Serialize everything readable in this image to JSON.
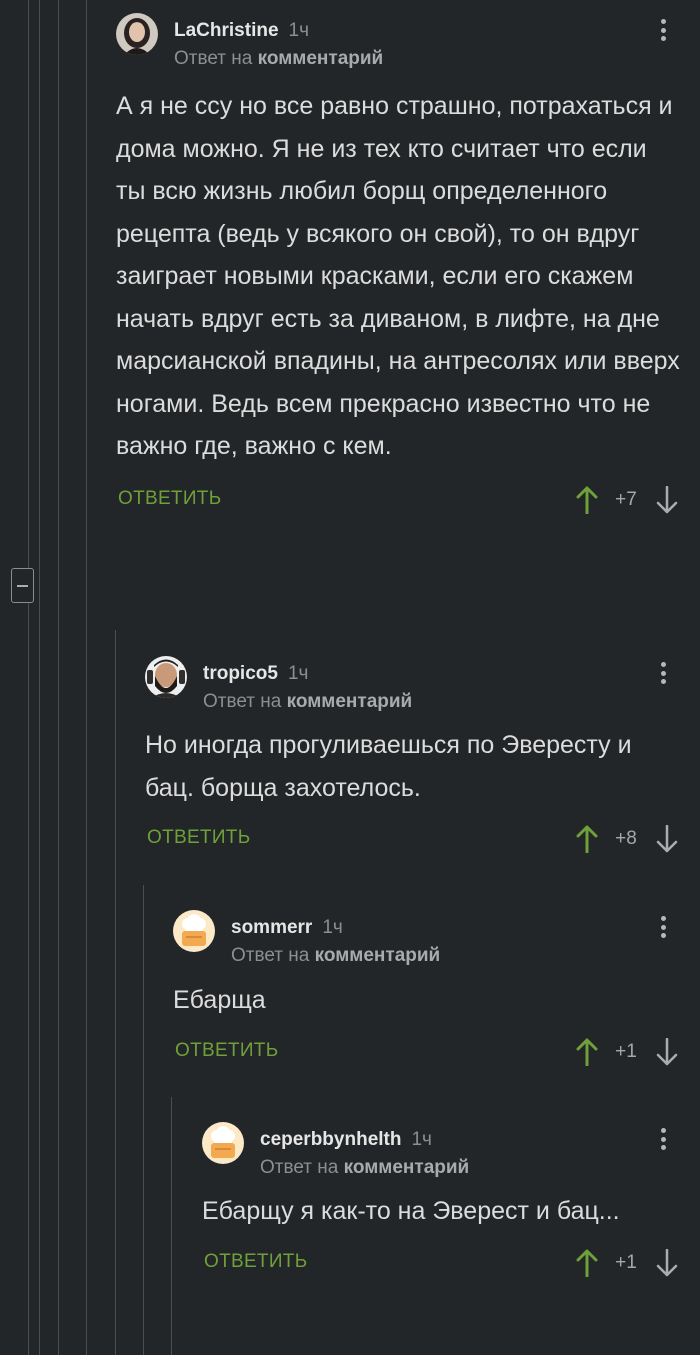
{
  "collapse_icon": "minus-square-icon",
  "comments": [
    {
      "author": "LaChristine",
      "time": "1ч",
      "reply_prefix": "Ответ на",
      "reply_link": "комментарий",
      "avatar": "avatar-woman",
      "text": "А я не ссу но все равно страшно, потрахаться и дома можно. Я не из тех кто считает что если ты всю жизнь любил борщ определенного рецепта (ведь у всякого он свой), то он вдруг заиграет новыми красками, если его скажем начать вдруг есть за диваном, в лифте, на дне марсианской впадины, на антресолях или вверх ногами. Ведь всем прекрасно известно что не важно где, важно с кем.",
      "reply_label": "ОТВЕТИТЬ",
      "score": "+7"
    },
    {
      "author": "tropico5",
      "time": "1ч",
      "reply_prefix": "Ответ на",
      "reply_link": "комментарий",
      "avatar": "avatar-bearded-man",
      "text": "Но иногда прогуливаешься по Эвересту и бац. борща захотелось.",
      "reply_label": "ОТВЕТИТЬ",
      "score": "+8"
    },
    {
      "author": "sommerr",
      "time": "1ч",
      "reply_prefix": "Ответ на",
      "reply_link": "комментарий",
      "avatar": "avatar-default-chef",
      "text": "Ебарща",
      "reply_label": "ОТВЕТИТЬ",
      "score": "+1"
    },
    {
      "author": "ceperbbynhelth",
      "time": "1ч",
      "reply_prefix": "Ответ на",
      "reply_link": "комментарий",
      "avatar": "avatar-default-chef",
      "text": "Ебарщу я как-то на Эверест и бац...",
      "reply_label": "ОТВЕТИТЬ",
      "score": "+1"
    }
  ],
  "colors": {
    "background": "#232628",
    "reply_green": "#6fa039",
    "upvote_green": "#6fa039",
    "muted": "#8b8f92"
  }
}
